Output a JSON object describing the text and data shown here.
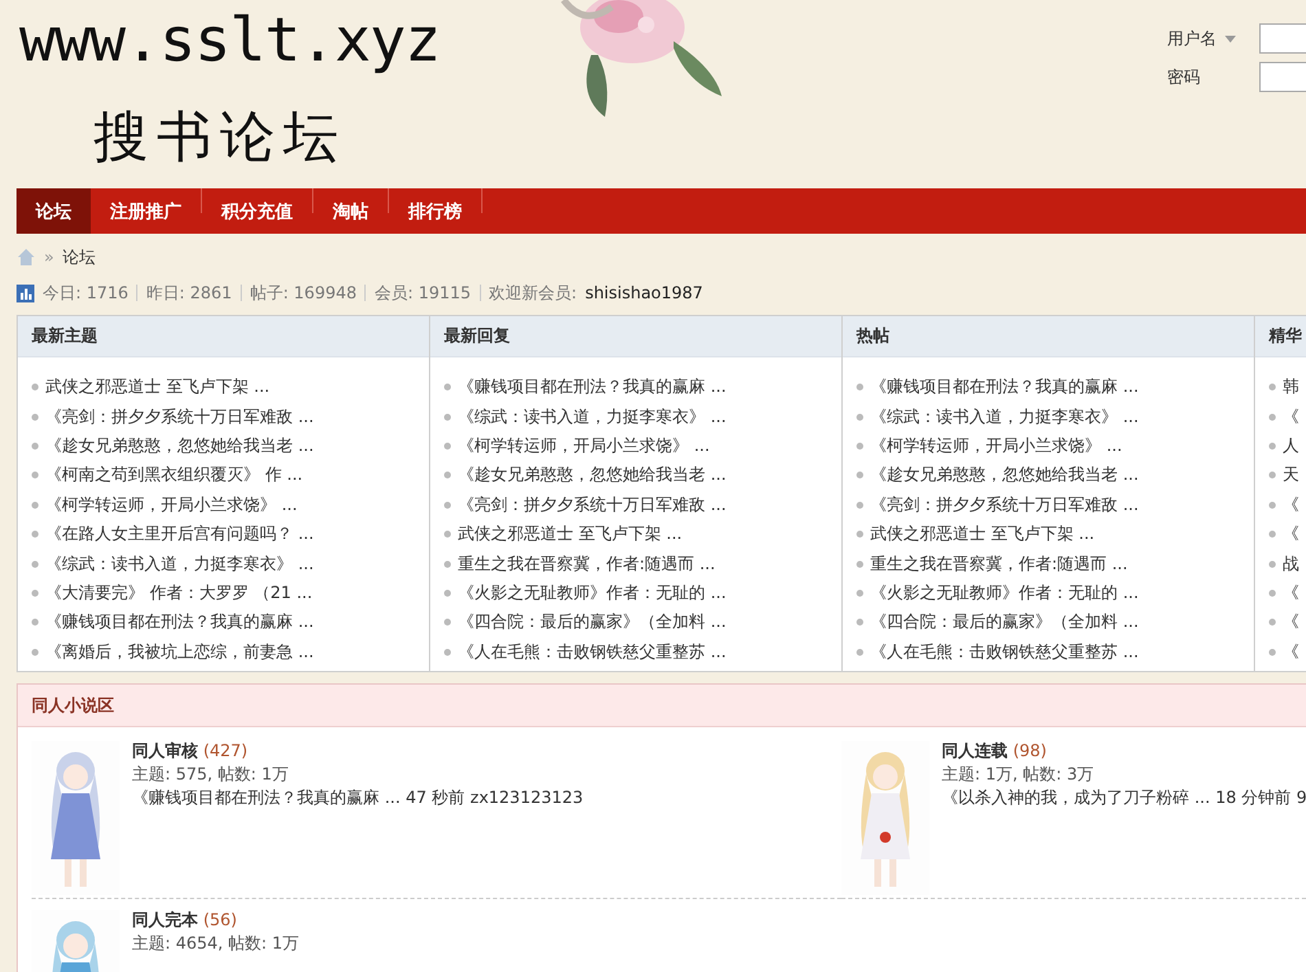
{
  "site": {
    "logo_url": "www.sslt.xyz",
    "logo_name": "搜书论坛"
  },
  "login": {
    "username_label": "用户名",
    "password_label": "密码"
  },
  "nav": [
    {
      "label": "论坛",
      "selected": true
    },
    {
      "label": "注册推广",
      "selected": false
    },
    {
      "label": "积分充值",
      "selected": false
    },
    {
      "label": "淘帖",
      "selected": false
    },
    {
      "label": "排行榜",
      "selected": false
    }
  ],
  "breadcrumb": {
    "separator": "»",
    "items": [
      "论坛"
    ]
  },
  "stats": {
    "items": [
      "今日: 1716",
      "昨日: 2861",
      "帖子: 169948",
      "会员: 19115"
    ],
    "welcome_label": "欢迎新会员:",
    "welcome_user": "shisishao1987"
  },
  "lists": [
    {
      "title": "最新主题",
      "items": [
        "武侠之邪恶道士 至飞卢下架 ...",
        "《亮剑：拼夕夕系统十万日军难敌 ...",
        "《趁女兄弟憨憨，忽悠她给我当老 ...",
        "《柯南之苟到黑衣组织覆灭》 作 ...",
        "《柯学转运师，开局小兰求饶》 ...",
        "《在路人女主里开后宫有问题吗？ ...",
        "《综武：读书入道，力挺李寒衣》 ...",
        "《大清要完》 作者：大罗罗 （21 ...",
        "《赚钱项目都在刑法？我真的赢麻 ...",
        "《离婚后，我被坑上恋综，前妻急 ..."
      ]
    },
    {
      "title": "最新回复",
      "items": [
        "《赚钱项目都在刑法？我真的赢麻 ...",
        "《综武：读书入道，力挺李寒衣》 ...",
        "《柯学转运师，开局小兰求饶》 ...",
        "《趁女兄弟憨憨，忽悠她给我当老 ...",
        "《亮剑：拼夕夕系统十万日军难敌 ...",
        "武侠之邪恶道士 至飞卢下架 ...",
        "重生之我在晋察冀，作者:随遇而 ...",
        "《火影之无耻教师》作者：无耻的 ...",
        "《四合院：最后的赢家》（全加料 ...",
        "《人在毛熊：击败钢铁慈父重整苏 ..."
      ]
    },
    {
      "title": "热帖",
      "items": [
        "《赚钱项目都在刑法？我真的赢麻 ...",
        "《综武：读书入道，力挺李寒衣》 ...",
        "《柯学转运师，开局小兰求饶》 ...",
        "《趁女兄弟憨憨，忽悠她给我当老 ...",
        "《亮剑：拼夕夕系统十万日军难敌 ...",
        "武侠之邪恶道士 至飞卢下架 ...",
        "重生之我在晋察冀，作者:随遇而 ...",
        "《火影之无耻教师》作者：无耻的 ...",
        "《四合院：最后的赢家》（全加料 ...",
        "《人在毛熊：击败钢铁慈父重整苏 ..."
      ]
    },
    {
      "title": "精华",
      "items": [
        "韩",
        "《",
        "人",
        "天",
        "《",
        "《",
        "战",
        "《",
        "《",
        "《"
      ]
    }
  ],
  "forum_section": {
    "title": "同人小说区",
    "forums": [
      {
        "name": "同人审核",
        "count": "(427)",
        "stats": "主题: 575, 帖数: 1万",
        "last_post": {
          "title": "《赚钱项目都在刑法？我真的赢麻 ...",
          "time": "47 秒前",
          "user": "zx123123123"
        }
      },
      {
        "name": "同人连载",
        "count": "(98)",
        "stats": "主题: 1万, 帖数: 3万",
        "last_post": {
          "title": "《以杀入神的我，成为了刀子粉碎 ...",
          "time": "18 分钟前",
          "user": "9"
        }
      },
      {
        "name": "同人完本",
        "count": "(56)",
        "stats": "主题: 4654, 帖数: 1万"
      }
    ]
  }
}
